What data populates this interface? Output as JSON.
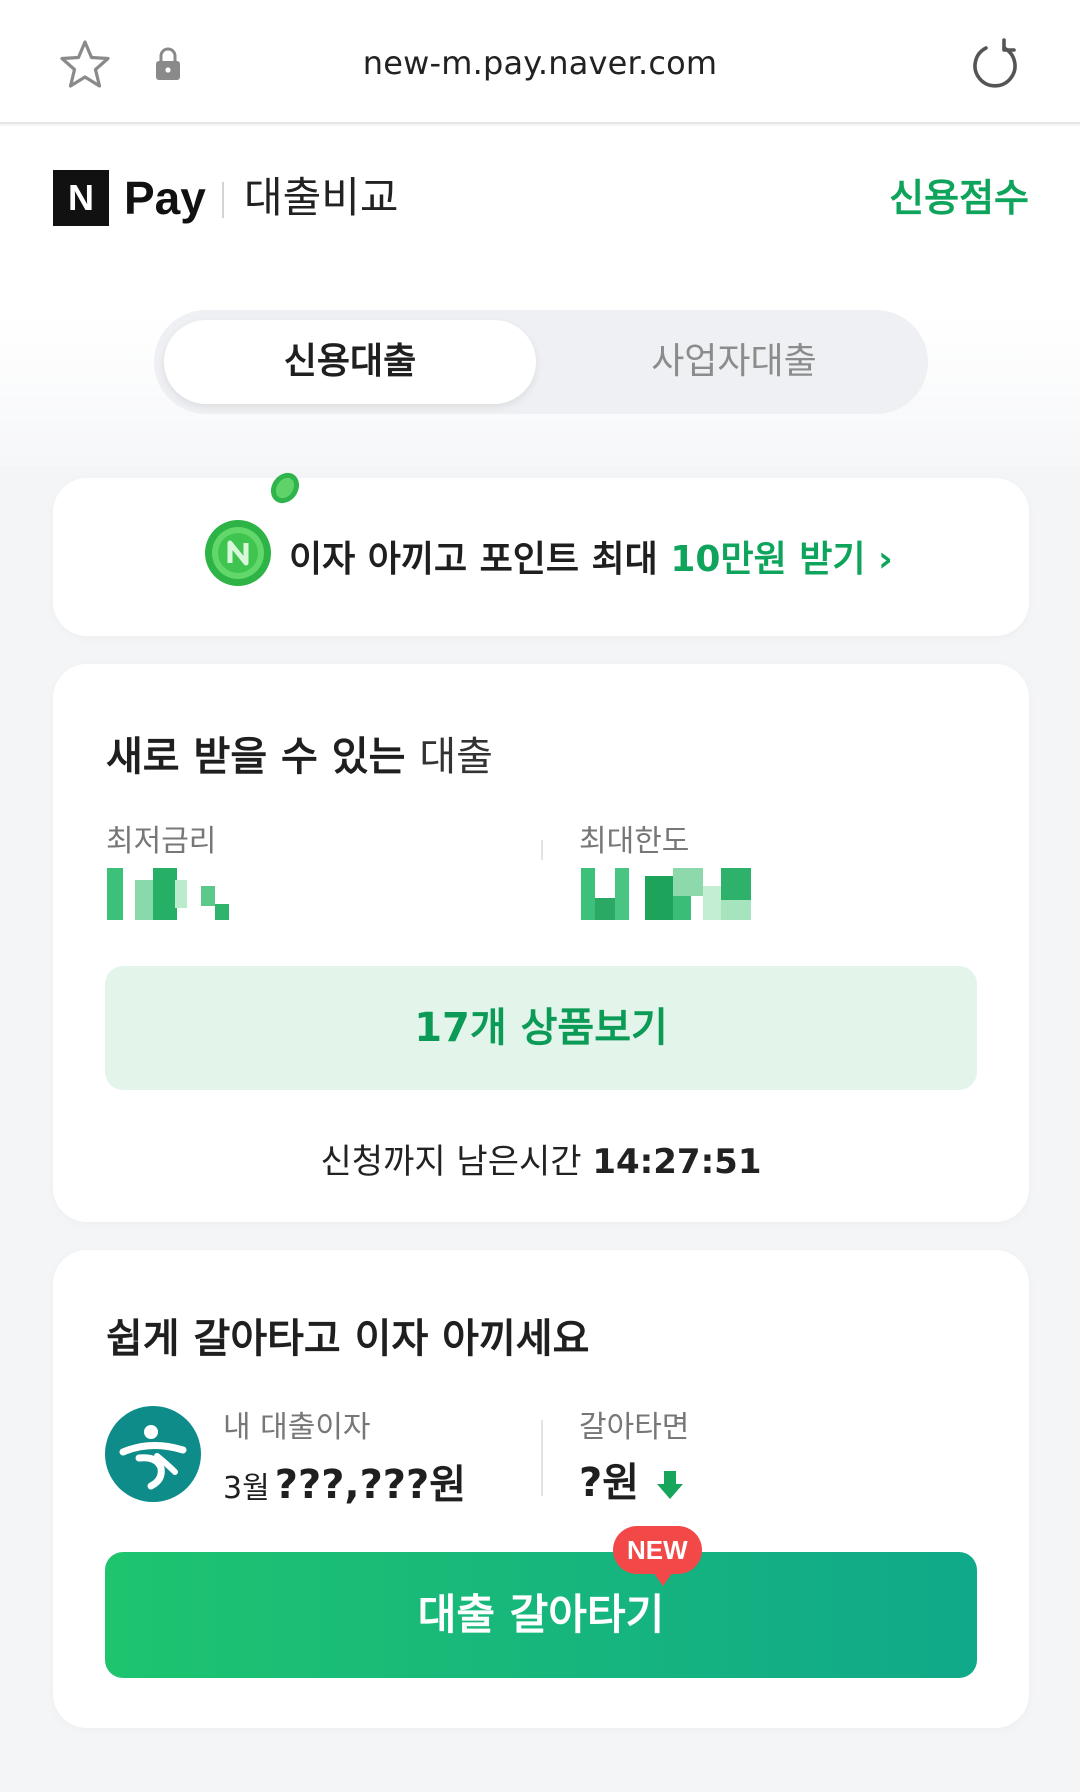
{
  "browser": {
    "url": "new-m.pay.naver.com",
    "icons": [
      "star-icon",
      "lock-icon",
      "reload-icon"
    ]
  },
  "header": {
    "logo_mark": "N",
    "logo_text": "Pay",
    "service_name": "대출비교",
    "credit_score_link": "신용점수"
  },
  "tabs": [
    {
      "label": "신용대출",
      "selected": true
    },
    {
      "label": "사업자대출",
      "selected": false
    }
  ],
  "promo": {
    "text_prefix": "이자 아끼고 포인트 최대",
    "text_highlight": "10만원 받기",
    "chevron": "›"
  },
  "new_loans": {
    "title_bold": "새로 받을 수 있는",
    "title_light": "대출",
    "min_rate_label": "최저금리",
    "max_limit_label": "최대한도",
    "view_button": "17개 상품보기",
    "timer_prefix": "신청까지 남은시간",
    "timer_value": "14:27:51"
  },
  "switch": {
    "title": "쉽게 갈아타고 이자 아끼세요",
    "my_interest_label": "내 대출이자",
    "month": "3월",
    "my_interest_value": "???,???원",
    "switch_label": "갈아타면",
    "switch_value": "?원",
    "badge": "NEW",
    "button": "대출 갈아타기"
  },
  "colors": {
    "brand_green": "#0fa45c",
    "button_gradient_start": "#1ec46e",
    "button_gradient_end": "#10a98a",
    "badge_red": "#f24848",
    "bank_teal": "#0e8c8a"
  }
}
